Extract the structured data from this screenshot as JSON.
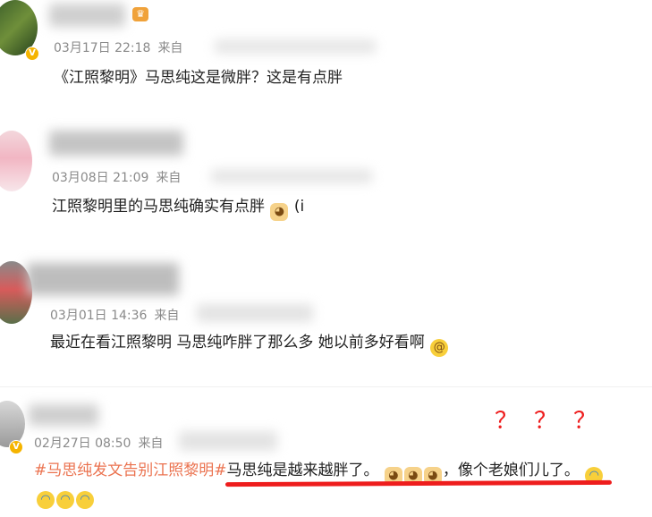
{
  "comments": [
    {
      "timestamp": "03月17日 22:18",
      "source_label": "来自",
      "text": "《江照黎明》马思纯这是微胖？这是有点胖"
    },
    {
      "timestamp": "03月08日 21:09",
      "source_label": "来自",
      "text": "江照黎明里的马思纯确实有点胖",
      "trailing_text": "(i"
    },
    {
      "timestamp": "03月01日 14:36",
      "source_label": "来自",
      "text": "最近在看江照黎明 马思纯咋胖了那么多 她以前多好看啊"
    },
    {
      "timestamp": "02月27日 08:50",
      "source_label": "来自",
      "topic": "#马思纯发文告别江照黎明#",
      "text": "马思纯是越来越胖了。",
      "text2": "，像个老娘们儿了。"
    }
  ],
  "annotation": {
    "question_marks": "？？？"
  },
  "icons": {
    "verified_badge": "V",
    "emoji_dog": "dog-face-emoji",
    "emoji_cry": "laugh-cry-emoji",
    "emoji_dizzy": "dizzy-face-emoji",
    "crown": "crown-icon"
  },
  "colors": {
    "topic": "#eb7350",
    "annotation_red": "#ee1d1d",
    "meta_gray": "#8a8a8a"
  }
}
